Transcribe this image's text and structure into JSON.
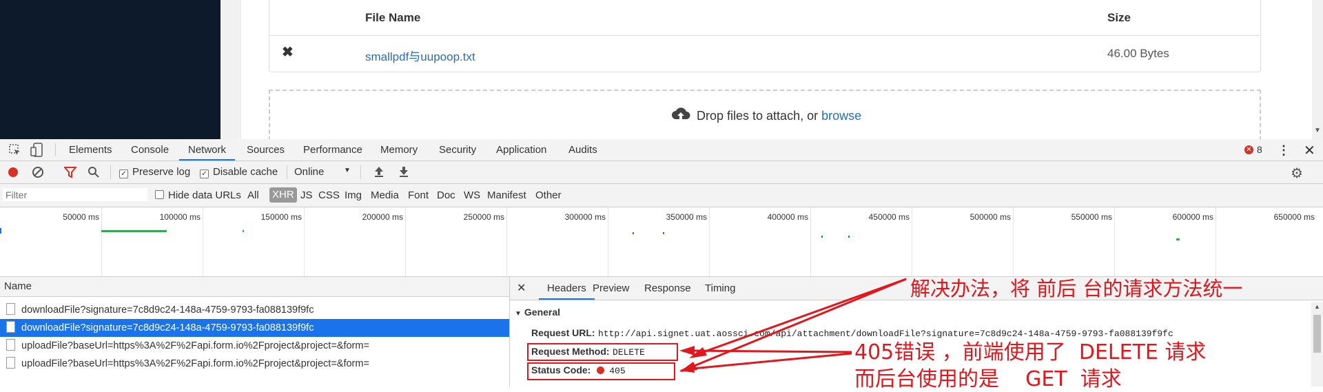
{
  "file_table": {
    "col_name": "File Name",
    "col_size": "Size",
    "rows": [
      {
        "name": "smallpdf与uupoop.txt",
        "size": "46.00 Bytes"
      }
    ]
  },
  "dropzone": {
    "text": "Drop files to attach, or ",
    "link": "browse"
  },
  "devtools": {
    "tabs": [
      "Elements",
      "Console",
      "Network",
      "Sources",
      "Performance",
      "Memory",
      "Security",
      "Application",
      "Audits"
    ],
    "active_tab": "Network",
    "error_count": "8",
    "toolbar": {
      "preserve_log": "Preserve log",
      "disable_cache": "Disable cache",
      "throttle": "Online"
    },
    "filter": {
      "placeholder": "Filter",
      "hide_data_urls": "Hide data URLs",
      "types": [
        "All",
        "XHR",
        "JS",
        "CSS",
        "Img",
        "Media",
        "Font",
        "Doc",
        "WS",
        "Manifest",
        "Other"
      ],
      "active_type": "XHR"
    },
    "timeline_ticks": [
      "50000 ms",
      "100000 ms",
      "150000 ms",
      "200000 ms",
      "250000 ms",
      "300000 ms",
      "350000 ms",
      "400000 ms",
      "450000 ms",
      "500000 ms",
      "550000 ms",
      "600000 ms",
      "650000 ms"
    ],
    "name_header": "Name",
    "requests": [
      "downloadFile?signature=7c8d9c24-148a-4759-9793-fa088139f9fc",
      "downloadFile?signature=7c8d9c24-148a-4759-9793-fa088139f9fc",
      "uploadFile?baseUrl=https%3A%2F%2Fapi.form.io%2Fproject&project=&form=",
      "uploadFile?baseUrl=https%3A%2F%2Fapi.form.io%2Fproject&project=&form="
    ],
    "selected_request": 1,
    "detail_tabs": [
      "Headers",
      "Preview",
      "Response",
      "Timing"
    ],
    "active_detail_tab": "Headers",
    "general": {
      "title": "General",
      "request_url_label": "Request URL:",
      "request_url": "http://api.signet.uat.aossci.com/api/attachment/downloadFile?signature=7c8d9c24-148a-4759-9793-fa088139f9fc",
      "method_label": "Request Method:",
      "method": "DELETE",
      "status_label": "Status Code:",
      "status": "405"
    }
  },
  "annotations": {
    "a1": "解决办法，将 前后 台的请求方法统一",
    "a2": "405错误 ，前端使用了  DELETE 请求",
    "a3": "而后台使用的是    GET  请求"
  },
  "colors": {
    "accent": "#1a73e8",
    "annotation": "#e0171d",
    "sidebar": "#0d1a2b",
    "link": "#2a6db3"
  }
}
